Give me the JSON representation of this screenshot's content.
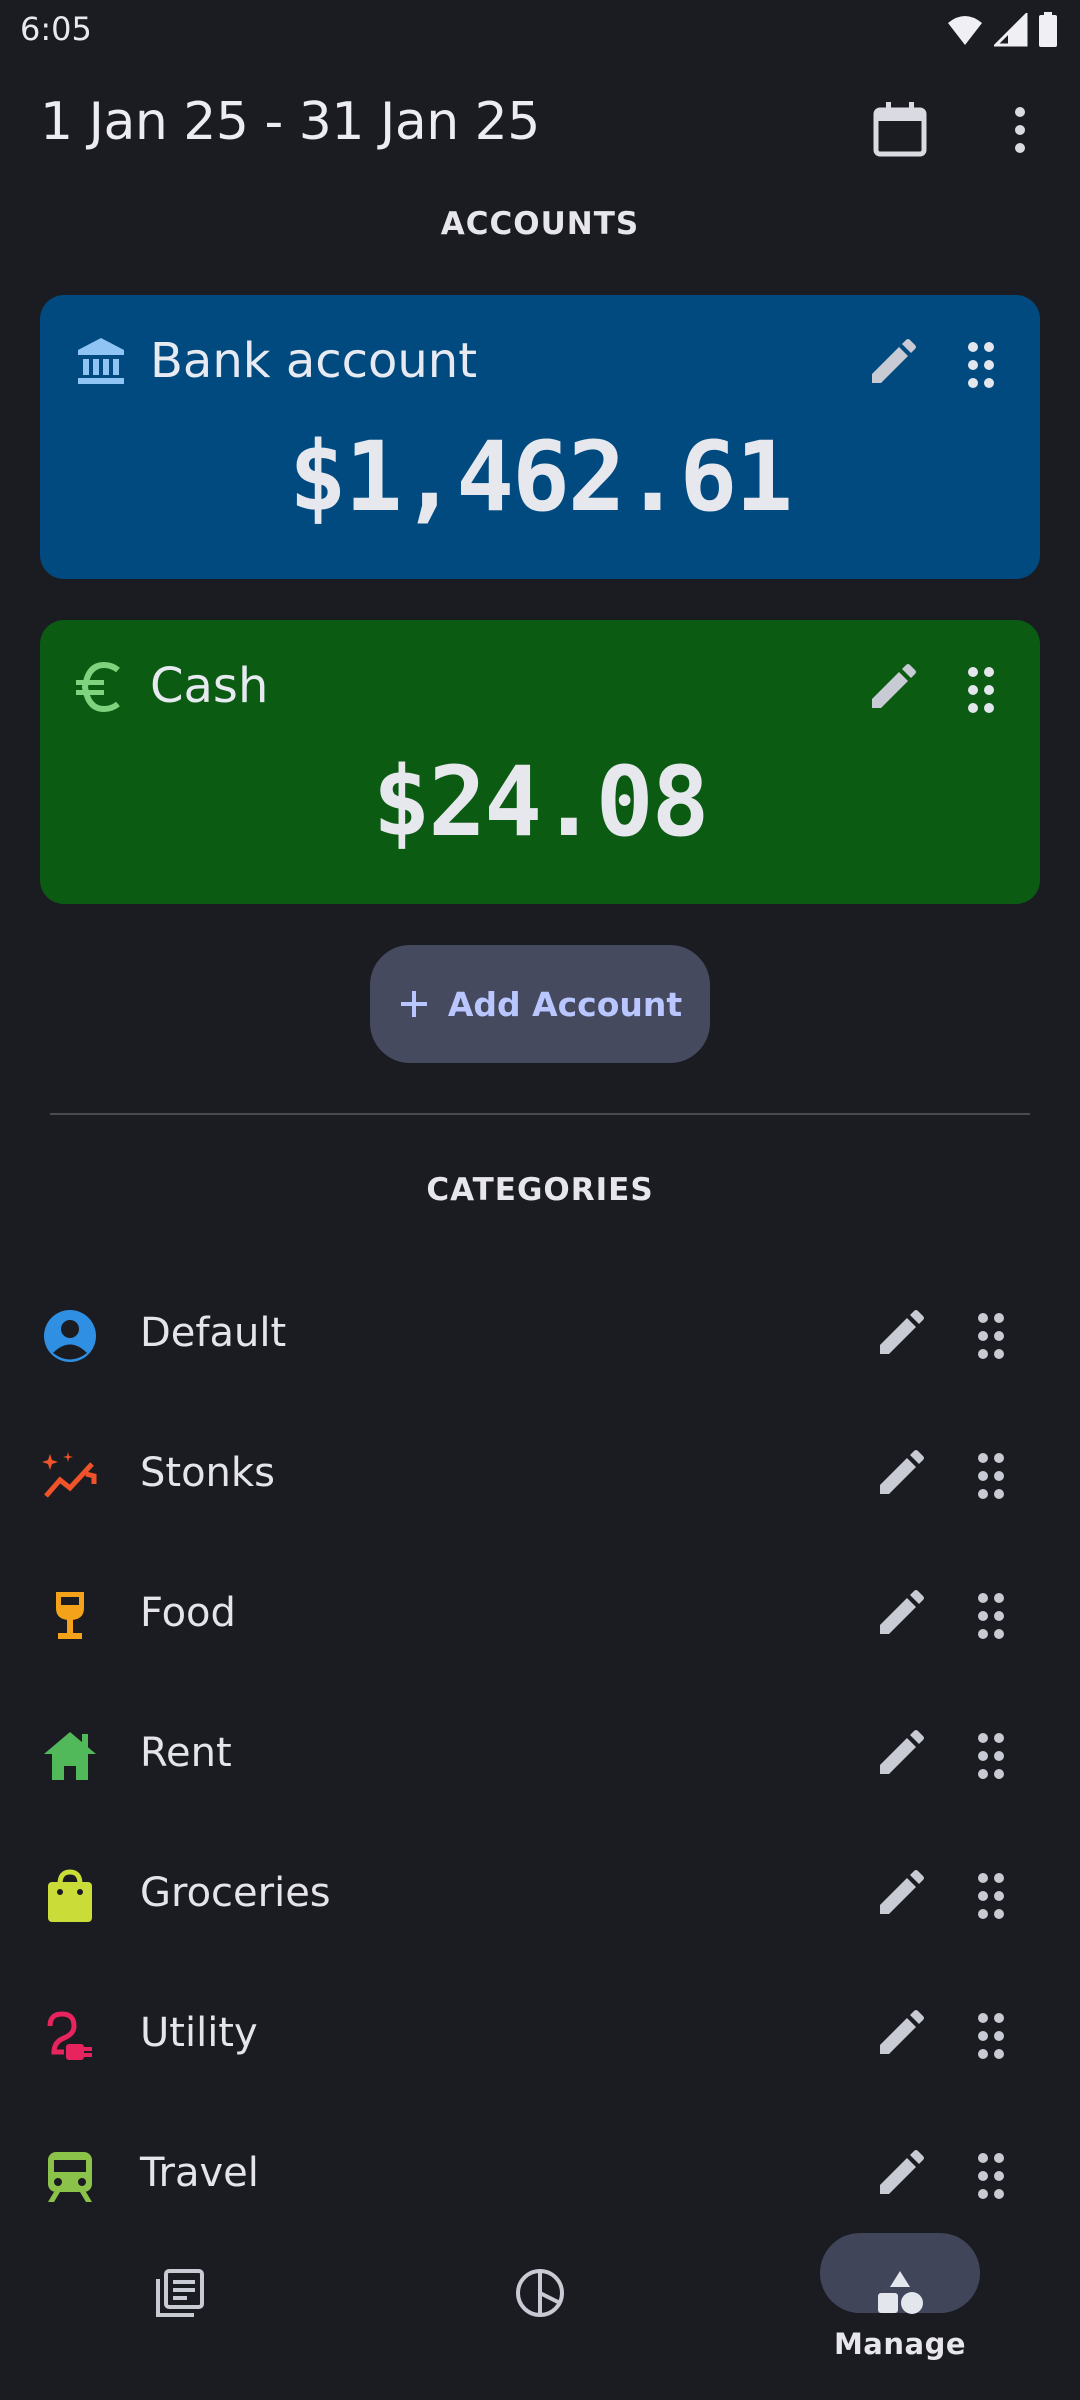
{
  "status_bar": {
    "time": "6:05",
    "icons": [
      "wifi-icon",
      "signal-icon",
      "battery-icon"
    ]
  },
  "header": {
    "date_range": "1 Jan 25 - 31 Jan 25",
    "calendar_icon": "calendar-icon",
    "more_icon": "more-vert-icon"
  },
  "accounts": {
    "title": "ACCOUNTS",
    "items": [
      {
        "name": "Bank account",
        "balance": "$1,462.61",
        "icon": "bank-icon",
        "color": "#004a80"
      },
      {
        "name": "Cash",
        "balance": "$24.08",
        "icon": "euro-icon",
        "color": "#0b5b12"
      }
    ],
    "add_label": "Add Account"
  },
  "categories": {
    "title": "CATEGORIES",
    "items": [
      {
        "label": "Default",
        "icon": "person-icon",
        "color": "#2f8fe3"
      },
      {
        "label": "Stonks",
        "icon": "trending-icon",
        "color": "#f0532a"
      },
      {
        "label": "Food",
        "icon": "wine-glass-icon",
        "color": "#f5a21b"
      },
      {
        "label": "Rent",
        "icon": "house-icon",
        "color": "#52b95a"
      },
      {
        "label": "Groceries",
        "icon": "shopping-bag-icon",
        "color": "#c9dc38"
      },
      {
        "label": "Utility",
        "icon": "plug-icon",
        "color": "#e8245f"
      },
      {
        "label": "Travel",
        "icon": "train-icon",
        "color": "#8bc34a"
      }
    ]
  },
  "bottom_nav": {
    "items": [
      {
        "icon": "transactions-icon",
        "label": ""
      },
      {
        "icon": "pie-chart-icon",
        "label": ""
      },
      {
        "icon": "shapes-icon",
        "label": "Manage",
        "active": true
      }
    ]
  }
}
